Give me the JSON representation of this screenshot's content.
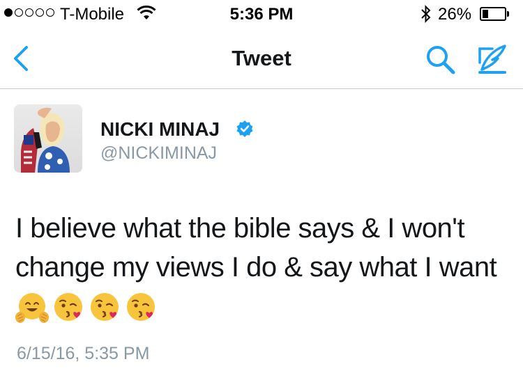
{
  "status_bar": {
    "carrier": "T-Mobile",
    "time": "5:36 PM",
    "battery_percent": "26%",
    "battery_level": 0.26,
    "signal_bars_filled": 1,
    "signal_bars_total": 5,
    "icons": [
      "signal-dots",
      "wifi-icon",
      "bluetooth-icon",
      "battery-icon"
    ]
  },
  "nav": {
    "title": "Tweet",
    "back_icon": "chevron-left-icon",
    "search_icon": "search-icon",
    "compose_icon": "compose-tweet-icon",
    "accent_color": "#1da1f2"
  },
  "tweet": {
    "display_name": "NICKI MINAJ",
    "handle": "@NICKIMINAJ",
    "verified": true,
    "text": "I believe what the bible says & I won't change my views I do & say what I want",
    "emojis": [
      "hugging-face-emoji",
      "face-blowing-kiss-emoji",
      "face-blowing-kiss-emoji",
      "face-blowing-kiss-emoji"
    ],
    "timestamp": "6/15/16, 5:35 PM"
  },
  "colors": {
    "text_primary": "#14171a",
    "text_secondary": "#8899a6",
    "accent": "#1da1f2",
    "divider": "#c8c7cc"
  }
}
